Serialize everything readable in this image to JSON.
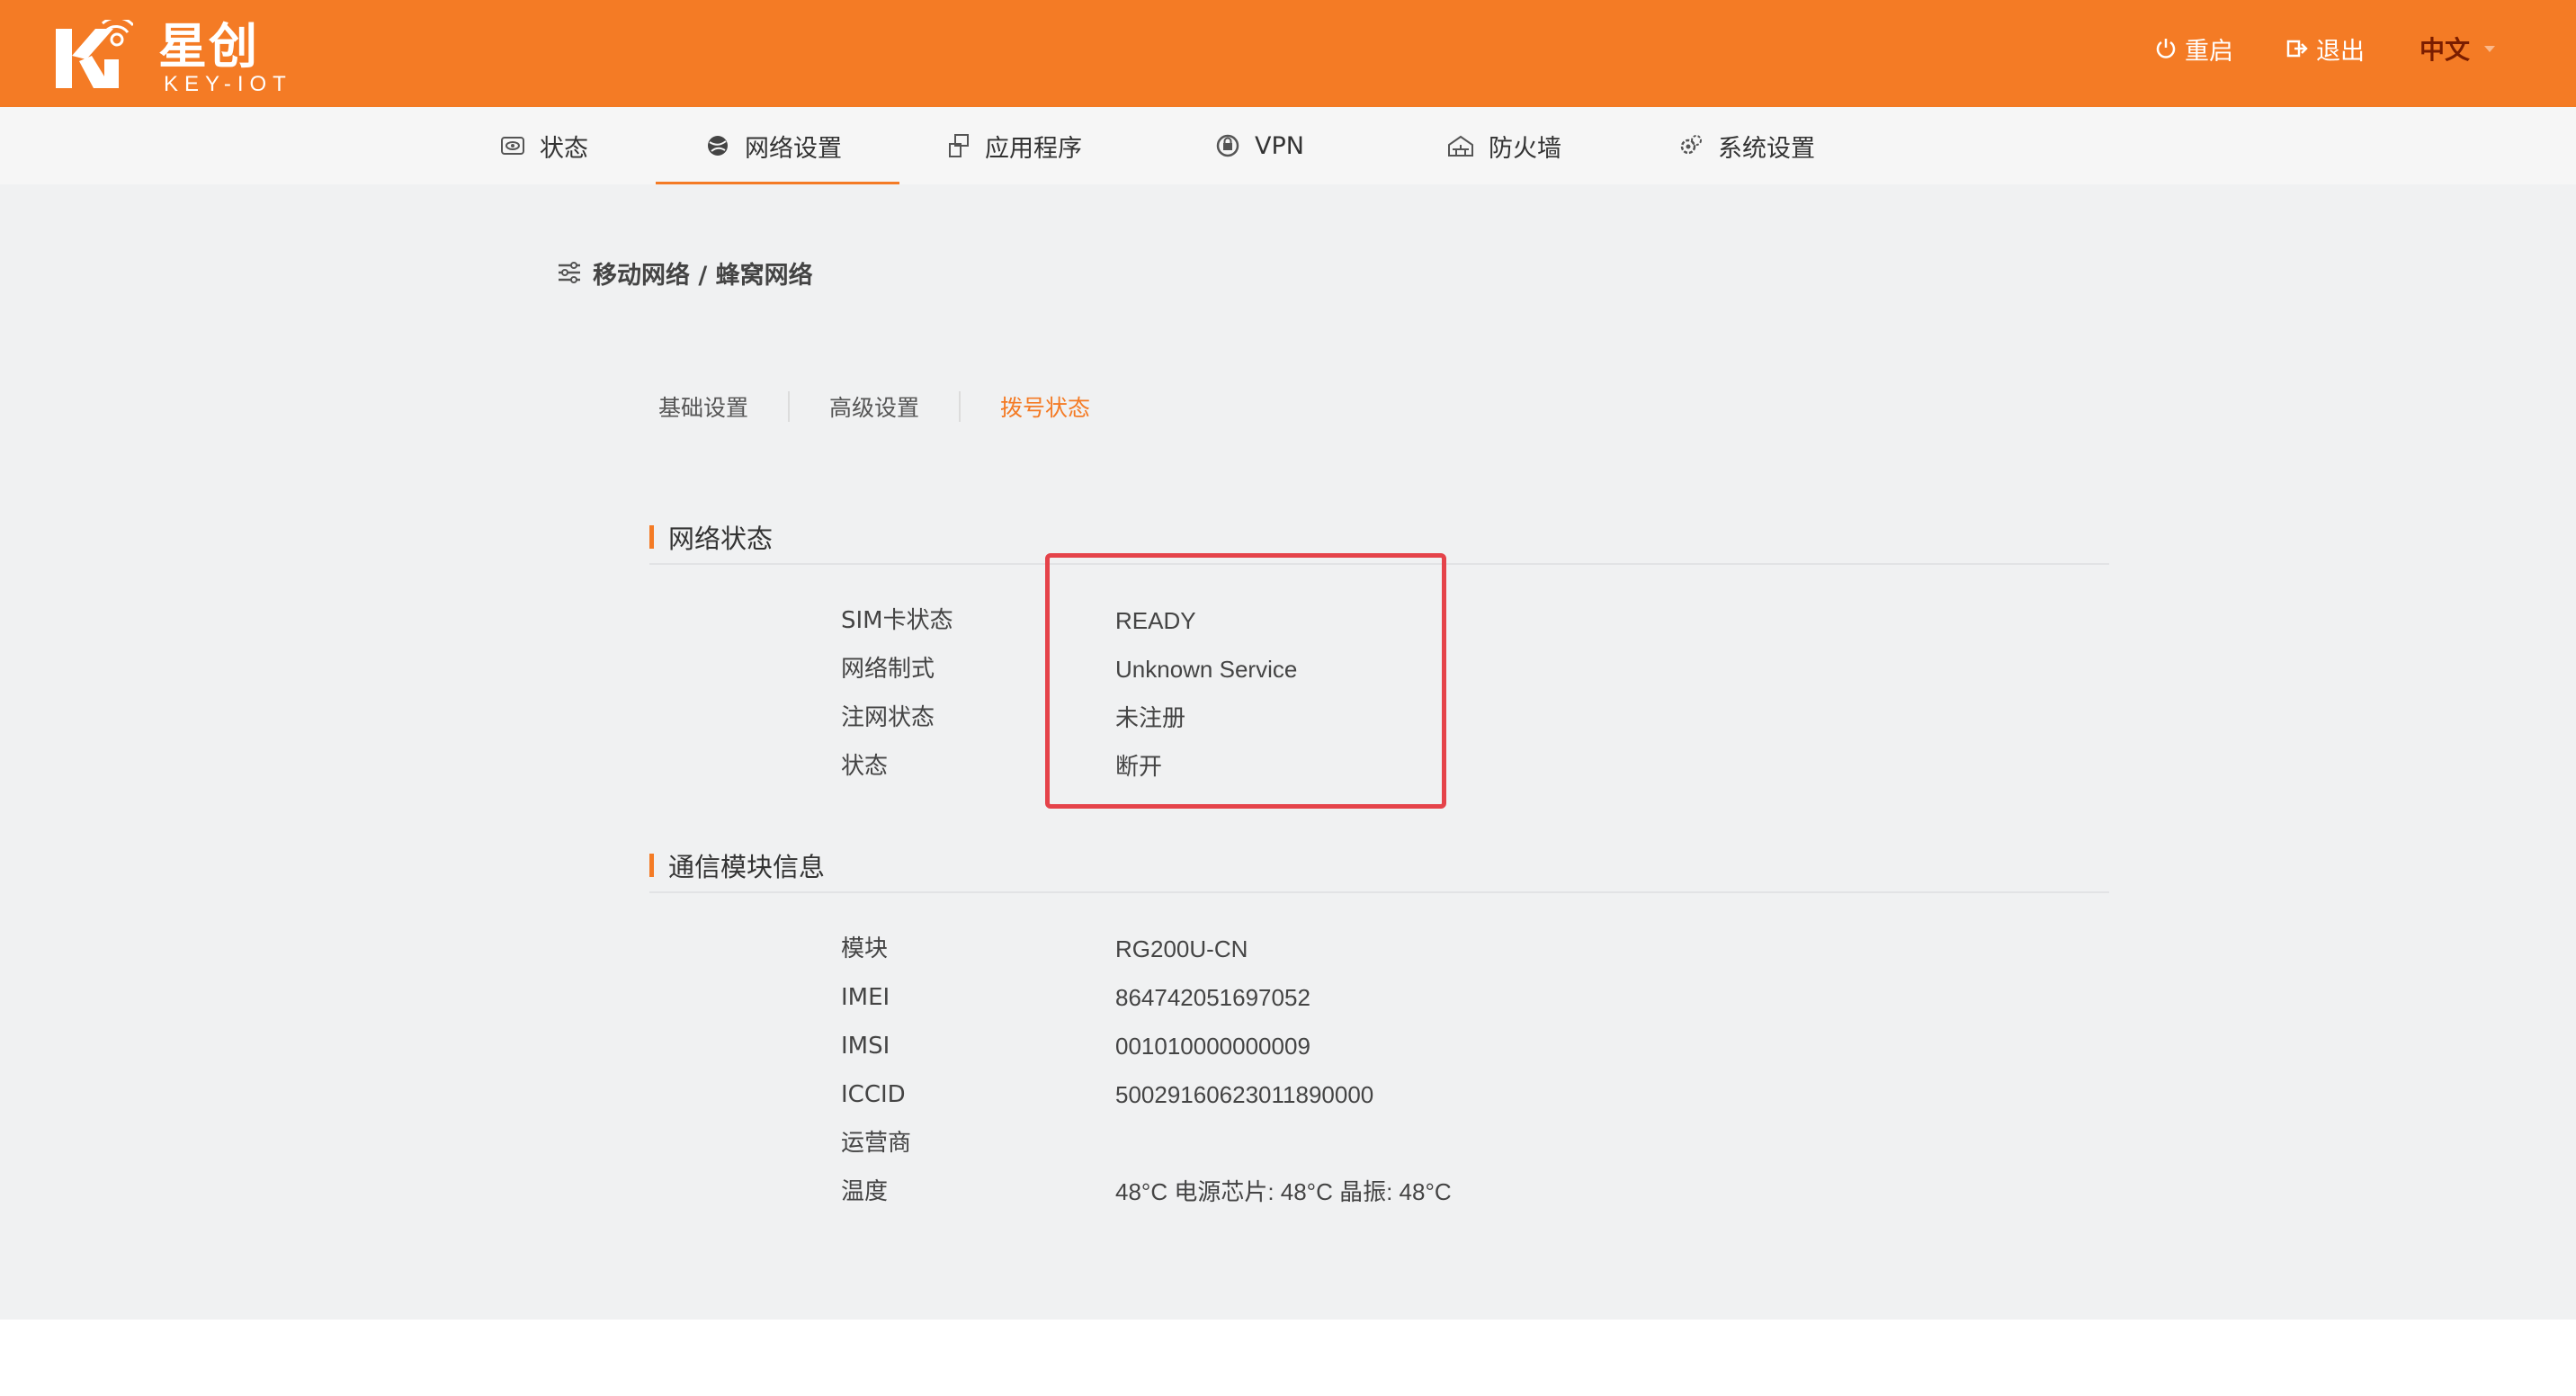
{
  "brand": {
    "name_cn": "星创",
    "name_en": "KEY-IOT"
  },
  "header": {
    "restart_label": "重启",
    "logout_label": "退出",
    "language": "中文"
  },
  "nav": {
    "items": [
      {
        "label": "状态",
        "icon": "status-eye-icon"
      },
      {
        "label": "网络设置",
        "icon": "globe-icon",
        "active": true
      },
      {
        "label": "应用程序",
        "icon": "app-icon"
      },
      {
        "label": "VPN",
        "icon": "vpn-icon"
      },
      {
        "label": "防火墙",
        "icon": "firewall-icon"
      },
      {
        "label": "系统设置",
        "icon": "gear-icon"
      }
    ]
  },
  "breadcrumb": "移动网络 / 蜂窝网络",
  "subtabs": [
    {
      "label": "基础设置"
    },
    {
      "label": "高级设置"
    },
    {
      "label": "拨号状态",
      "active": true
    }
  ],
  "network_status": {
    "title": "网络状态",
    "rows": [
      {
        "label": "SIM卡状态",
        "value": "READY"
      },
      {
        "label": "网络制式",
        "value": "Unknown Service"
      },
      {
        "label": "注网状态",
        "value": "未注册"
      },
      {
        "label": "状态",
        "value": "断开"
      }
    ]
  },
  "module_info": {
    "title": "通信模块信息",
    "rows": [
      {
        "label": "模块",
        "value": "RG200U-CN"
      },
      {
        "label": "IMEI",
        "value": "864742051697052"
      },
      {
        "label": "IMSI",
        "value": "001010000000009"
      },
      {
        "label": "ICCID",
        "value": "50029160623011890000"
      },
      {
        "label": "运营商",
        "value": ""
      },
      {
        "label": "温度",
        "value": "48°C 电源芯片: 48°C 晶振: 48°C"
      }
    ]
  },
  "colors": {
    "brand_orange": "#f47b25",
    "highlight_red": "#e5434a",
    "language_text": "#7a1d00"
  }
}
